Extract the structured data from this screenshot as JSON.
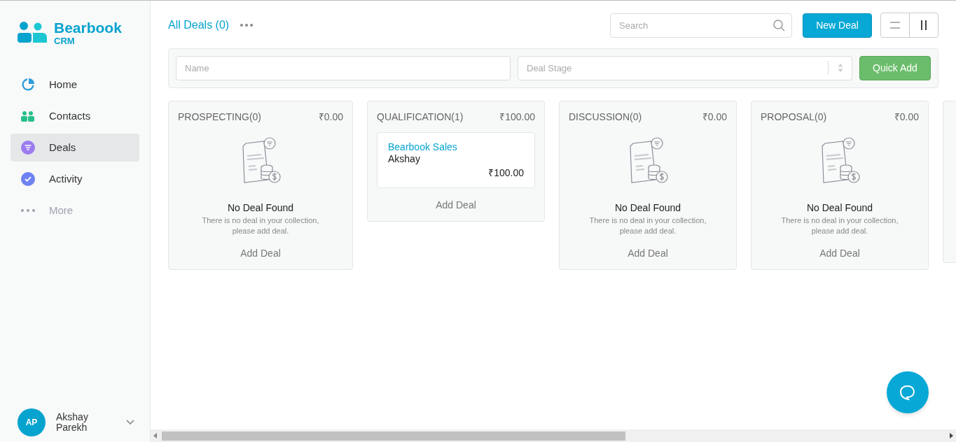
{
  "brand": {
    "name": "Bearbook",
    "sub": "CRM"
  },
  "sidebar": {
    "items": [
      {
        "label": "Home",
        "kind": "pie",
        "selected": false,
        "muted": false
      },
      {
        "label": "Contacts",
        "kind": "people",
        "selected": false,
        "muted": false
      },
      {
        "label": "Deals",
        "kind": "funnel",
        "selected": true,
        "muted": false
      },
      {
        "label": "Activity",
        "kind": "check",
        "selected": false,
        "muted": false
      },
      {
        "label": "More",
        "kind": "dots",
        "selected": false,
        "muted": true
      }
    ]
  },
  "user": {
    "initials": "AP",
    "name": "Akshay Parekh"
  },
  "header": {
    "title": "All Deals (0)",
    "search_placeholder": "Search",
    "new_button": "New Deal",
    "views": [
      {
        "kind": "list",
        "selected": false
      },
      {
        "kind": "board",
        "selected": true
      }
    ]
  },
  "filters": {
    "name_placeholder": "Name",
    "stage_placeholder": "Deal Stage",
    "button": "Quick Add"
  },
  "columns": [
    {
      "title": "PROSPECTING(0)",
      "amount": "₹0.00",
      "empty_title": "No Deal Found",
      "empty_text": "There is no deal in your collection, please add deal.",
      "add": "Add Deal"
    },
    {
      "title": "QUALIFICATION(1)",
      "amount": "₹100.00",
      "deals": [
        {
          "name": "Bearbook Sales",
          "owner": "Akshay",
          "amount": "₹100.00"
        }
      ],
      "add": "Add Deal"
    },
    {
      "title": "DISCUSSION(0)",
      "amount": "₹0.00",
      "empty_title": "No Deal Found",
      "empty_text": "There is no deal in your collection, please add deal.",
      "add": "Add Deal"
    },
    {
      "title": "PROPOSAL(0)",
      "amount": "₹0.00",
      "empty_title": "No Deal Found",
      "empty_text": "There is no deal in your collection, please add deal.",
      "add": "Add Deal"
    }
  ]
}
